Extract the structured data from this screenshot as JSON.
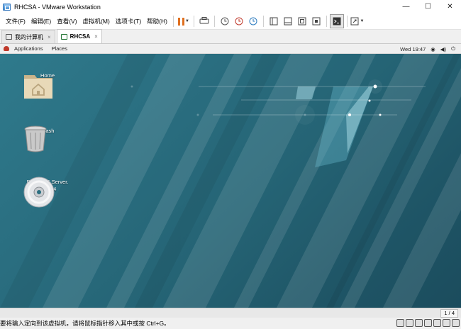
{
  "window": {
    "title": "RHCSA - VMware Workstation",
    "minimize": "—",
    "maximize": "☐",
    "close": "✕"
  },
  "menu": {
    "items": [
      "文件(F)",
      "编辑(E)",
      "查看(V)",
      "虚拟机(M)",
      "选项卡(T)",
      "帮助(H)"
    ]
  },
  "tabs": [
    {
      "label": "我的计算机",
      "close": "×",
      "active": false
    },
    {
      "label": "RHCSA",
      "close": "×",
      "active": true
    }
  ],
  "guest_panel": {
    "applications": "Applications",
    "places": "Places",
    "clock": "Wed 19:47"
  },
  "desktop_icons": {
    "home": "Home",
    "trash": "Trash",
    "disc_line1": "RHEL-7.5 Server.",
    "disc_line2": "x86_64"
  },
  "status": {
    "page_indicator": "1 / 4",
    "message": "要将输入定向到该虚拟机，请将鼠标指针移入其中或按 Ctrl+G。"
  },
  "colors": {
    "accent": "#e07020",
    "desktop_bg": "#2a6e80",
    "rhel_red": "#c0392b"
  }
}
